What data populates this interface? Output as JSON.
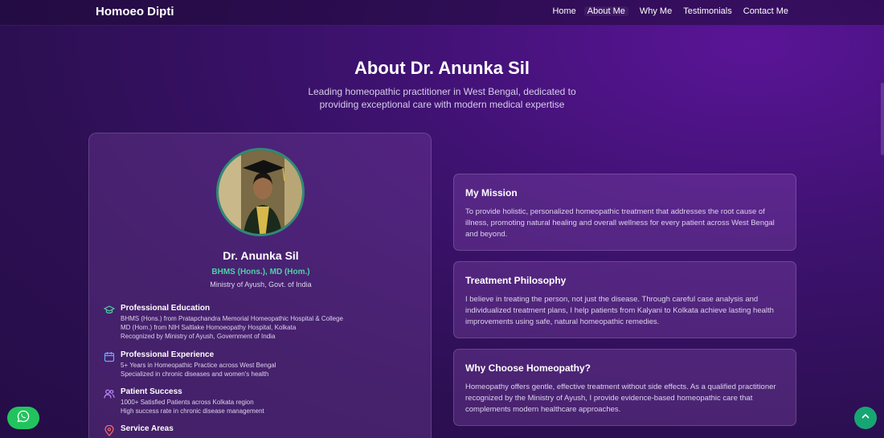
{
  "nav": {
    "brand": "Homoeo Dipti",
    "links": [
      "Home",
      "About Me",
      "Why Me",
      "Testimonials",
      "Contact Me"
    ]
  },
  "section": {
    "title": "About Dr. Anunka Sil",
    "subtitle": "Leading homeopathic practitioner in West Bengal, dedicated to providing exceptional care with modern medical expertise"
  },
  "profile": {
    "name": "Dr. Anunka Sil",
    "degree": "BHMS (Hons.), MD (Hom.)",
    "ministry": "Ministry of Ayush, Govt. of India",
    "items": [
      {
        "icon": "graduation-cap-icon",
        "title": "Professional Education",
        "lines": [
          "BHMS (Hons.) from Pratapchandra Memorial Homeopathic Hospital & College",
          "MD (Hom.) from NIH Saltlake Homoeopathy Hospital, Kolkata",
          "Recognized by Ministry of Ayush, Government of India"
        ]
      },
      {
        "icon": "calendar-icon",
        "title": "Professional Experience",
        "lines": [
          "5+ Years in Homeopathic Practice across West Bengal",
          "Specialized in chronic diseases and women's health"
        ]
      },
      {
        "icon": "users-icon",
        "title": "Patient Success",
        "lines": [
          "1000+ Satisfied Patients across Kolkata region",
          "High success rate in chronic disease management"
        ]
      },
      {
        "icon": "map-pin-icon",
        "title": "Service Areas",
        "lines": []
      }
    ]
  },
  "cards": [
    {
      "title": "My Mission",
      "body": "To provide holistic, personalized homeopathic treatment that addresses the root cause of illness, promoting natural healing and overall wellness for every patient across West Bengal and beyond."
    },
    {
      "title": "Treatment Philosophy",
      "body": "I believe in treating the person, not just the disease. Through careful case analysis and individualized treatment plans, I help patients from Kalyani to Kolkata achieve lasting health improvements using safe, natural homeopathic remedies."
    },
    {
      "title": "Why Choose Homeopathy?",
      "body": "Homeopathy offers gentle, effective treatment without side effects. As a qualified practitioner recognized by the Ministry of Ayush, I provide evidence-based homeopathic care that complements modern healthcare approaches."
    }
  ],
  "colors": {
    "accent_green": "#4fd1a5",
    "whatsapp": "#22c35e",
    "scroll_top": "#17a673"
  }
}
